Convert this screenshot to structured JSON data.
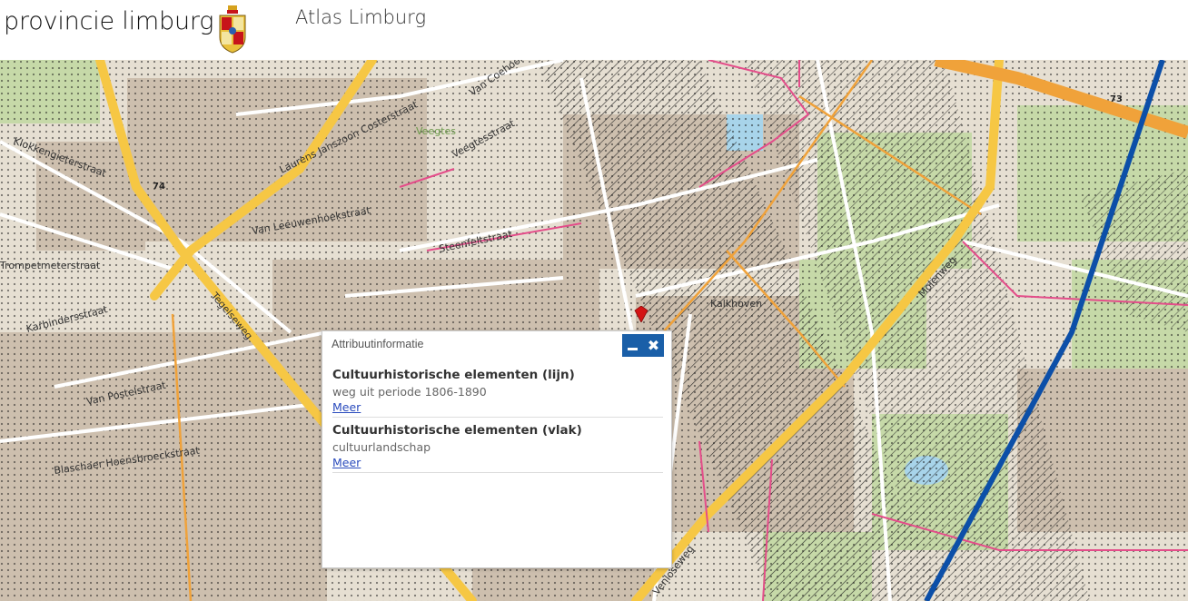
{
  "header": {
    "brand": "provincie limburg",
    "app_title": "Atlas Limburg"
  },
  "map": {
    "street_labels": [
      "Klokkengieterstraat",
      "Laurens Janszoon Costerstraat",
      "Van Coehoornstraat",
      "Veegtes",
      "Veegtesstraat",
      "Van Leeuwenhoekstraat",
      "Steenfeltstraat",
      "Trompetmeterstraat",
      "Karbindersstraat",
      "Van Postelstraat",
      "Blaschaer Hoensbroeckstraat",
      "Tegelseweg",
      "Venloseweg",
      "Molenweg",
      "Kalkhoven"
    ],
    "road_numbers": [
      "74",
      "73"
    ]
  },
  "popup": {
    "title": "Attribuutinformatie",
    "entries": [
      {
        "title": "Cultuurhistorische elementen (lijn)",
        "description": "weg uit periode 1806-1890",
        "link": "Meer"
      },
      {
        "title": "Cultuurhistorische elementen (vlak)",
        "description": "cultuurlandschap",
        "link": "Meer"
      }
    ]
  },
  "colors": {
    "popup_header_controls": "#1a5fa8",
    "main_road": "#f6c744",
    "railway_line": "#0c4fa8",
    "pink_boundary": "#e44d8a",
    "orange_road": "#f0a23a"
  }
}
